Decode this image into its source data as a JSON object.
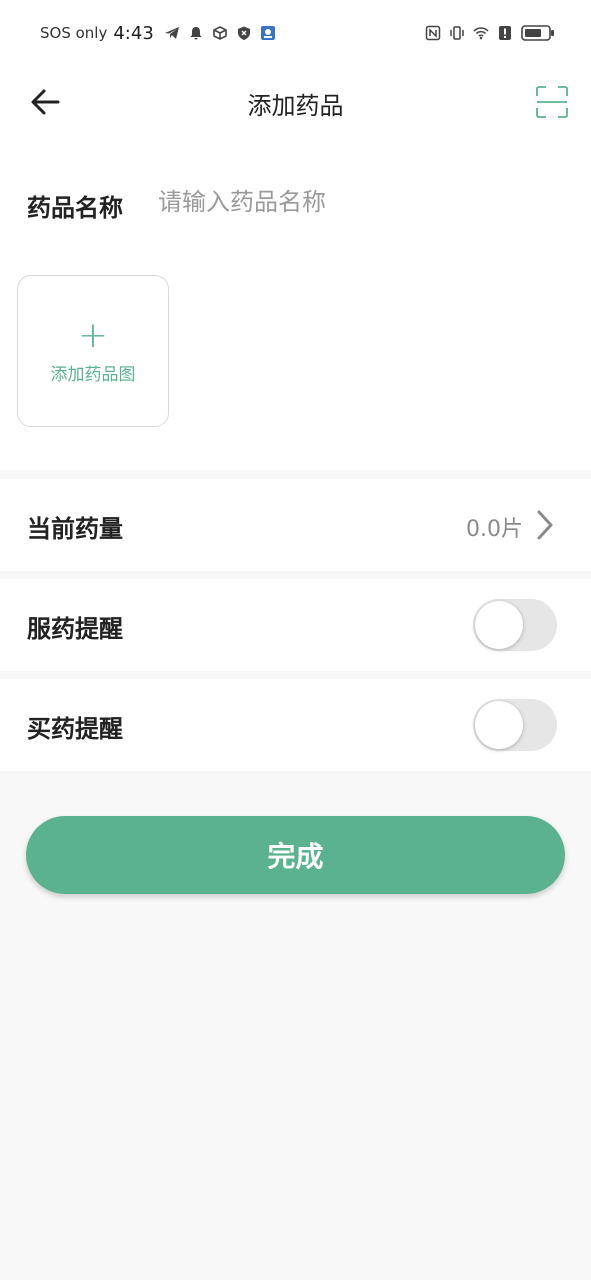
{
  "status_bar": {
    "carrier_text": "SOS only",
    "time": "4:43",
    "icons_left": [
      "telegram-icon",
      "bell-icon",
      "box-icon",
      "shield-icon",
      "app-icon"
    ],
    "icons_right": [
      "nfc-icon",
      "vibrate-icon",
      "wifi-icon",
      "alert-icon",
      "battery-icon"
    ]
  },
  "header": {
    "title": "添加药品",
    "back_icon": "arrow-left-icon",
    "scan_icon": "scan-icon"
  },
  "form": {
    "name_label": "药品名称",
    "name_placeholder": "请输入药品名称",
    "name_value": "",
    "add_image_label": "添加药品图"
  },
  "rows": [
    {
      "label": "当前药量",
      "value": "0.0片"
    },
    {
      "label": "服药提醒",
      "toggle": false
    },
    {
      "label": "买药提醒",
      "toggle": false
    }
  ],
  "done_label": "完成",
  "colors": {
    "accent": "#5bb28f",
    "background": "#f8f8f8",
    "toggle_off": "#e6e6e6"
  }
}
